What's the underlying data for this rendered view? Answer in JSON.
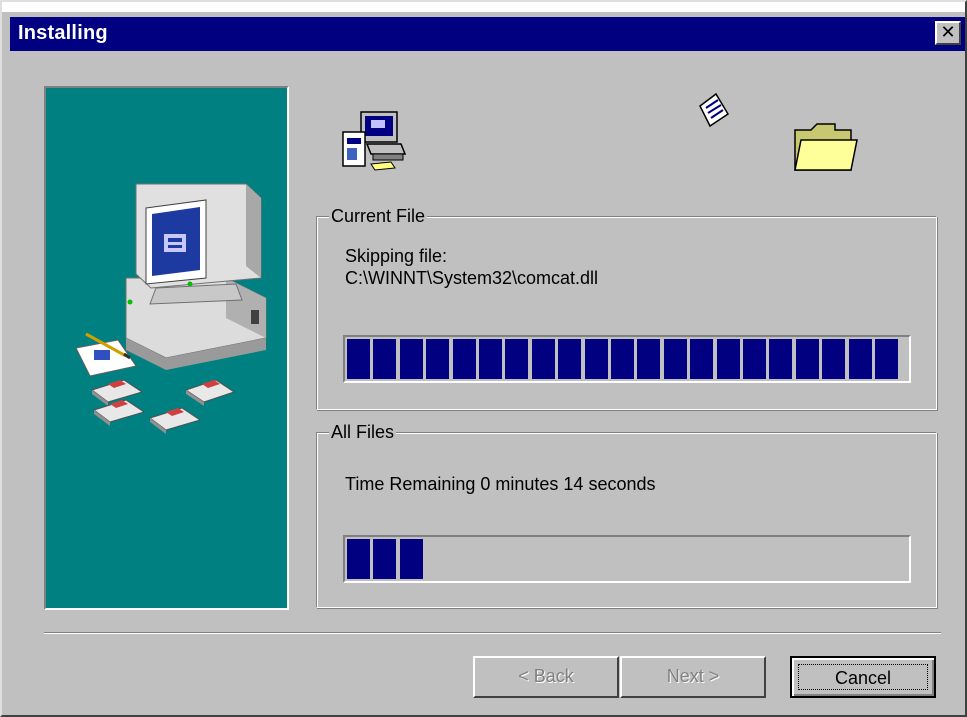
{
  "window": {
    "title": "Installing",
    "close_label": "✕"
  },
  "current_file": {
    "group_label": "Current File",
    "status_line": "Skipping file:",
    "file_path": "C:\\WINNT\\System32\\comcat.dll",
    "progress_fraction": 1.0
  },
  "all_files": {
    "group_label": "All Files",
    "time_remaining": "Time Remaining 0 minutes 14 seconds",
    "progress_fraction": 0.14
  },
  "buttons": {
    "back_label": "< Back",
    "next_label": "Next >",
    "cancel_label": "Cancel"
  },
  "colors": {
    "titlebar": "#000080",
    "panel": "#008080",
    "progress_fill": "#000080",
    "face": "#c0c0c0"
  },
  "icons": {
    "side_panel": "computer-setup-illustration-icon",
    "source": "computer-icon",
    "flying_file": "document-icon",
    "destination": "folder-icon"
  }
}
